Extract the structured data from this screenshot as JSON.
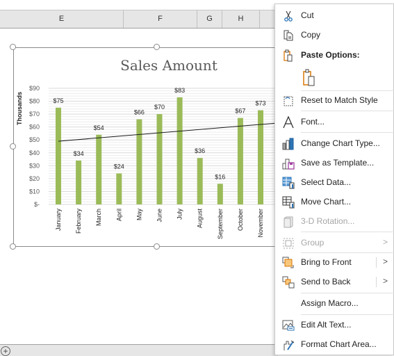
{
  "sheet": {
    "columns": [
      "E",
      "F",
      "G",
      "H"
    ],
    "add_sheet_symbol": "+"
  },
  "chart_data": {
    "type": "bar",
    "title": "Sales Amount",
    "xlabel": "",
    "ylabel": "Thousands",
    "categories": [
      "January",
      "February",
      "March",
      "April",
      "May",
      "June",
      "July",
      "August",
      "September",
      "October",
      "November"
    ],
    "values": [
      75,
      34,
      54,
      24,
      66,
      70,
      83,
      36,
      16,
      67,
      73
    ],
    "data_labels": [
      "$75",
      "$34",
      "$54",
      "$24",
      "$66",
      "$70",
      "$83",
      "$36",
      "$16",
      "$67",
      "$73"
    ],
    "yticks": [
      "$-",
      "$10",
      "$20",
      "$30",
      "$40",
      "$50",
      "$60",
      "$70",
      "$80",
      "$90"
    ],
    "ylim": [
      0,
      90
    ],
    "grid": true,
    "bar_color": "#9bbb59",
    "trendline": {
      "type": "linear",
      "start": 49,
      "end": 63
    }
  },
  "context_menu": {
    "items": [
      {
        "label": "Cut",
        "icon": "scissors-icon"
      },
      {
        "label": "Copy",
        "icon": "copy-icon"
      },
      {
        "label": "Paste Options:",
        "icon": "paste-icon"
      },
      {
        "label": "Reset to Match Style",
        "icon": "reset-style-icon"
      },
      {
        "label": "Font...",
        "icon": "font-icon"
      },
      {
        "label": "Change Chart Type...",
        "icon": "chart-type-icon"
      },
      {
        "label": "Save as Template...",
        "icon": "save-template-icon"
      },
      {
        "label": "Select Data...",
        "icon": "select-data-icon"
      },
      {
        "label": "Move Chart...",
        "icon": "move-chart-icon"
      },
      {
        "label": "3-D Rotation...",
        "icon": "rotation-3d-icon"
      },
      {
        "label": "Group",
        "icon": "group-icon"
      },
      {
        "label": "Bring to Front",
        "icon": "bring-front-icon"
      },
      {
        "label": "Send to Back",
        "icon": "send-back-icon"
      },
      {
        "label": "Assign Macro...",
        "icon": ""
      },
      {
        "label": "Edit Alt Text...",
        "icon": "alt-text-icon"
      },
      {
        "label": "Format Chart Area...",
        "icon": "format-area-icon"
      }
    ],
    "submenu_arrow": ">"
  }
}
